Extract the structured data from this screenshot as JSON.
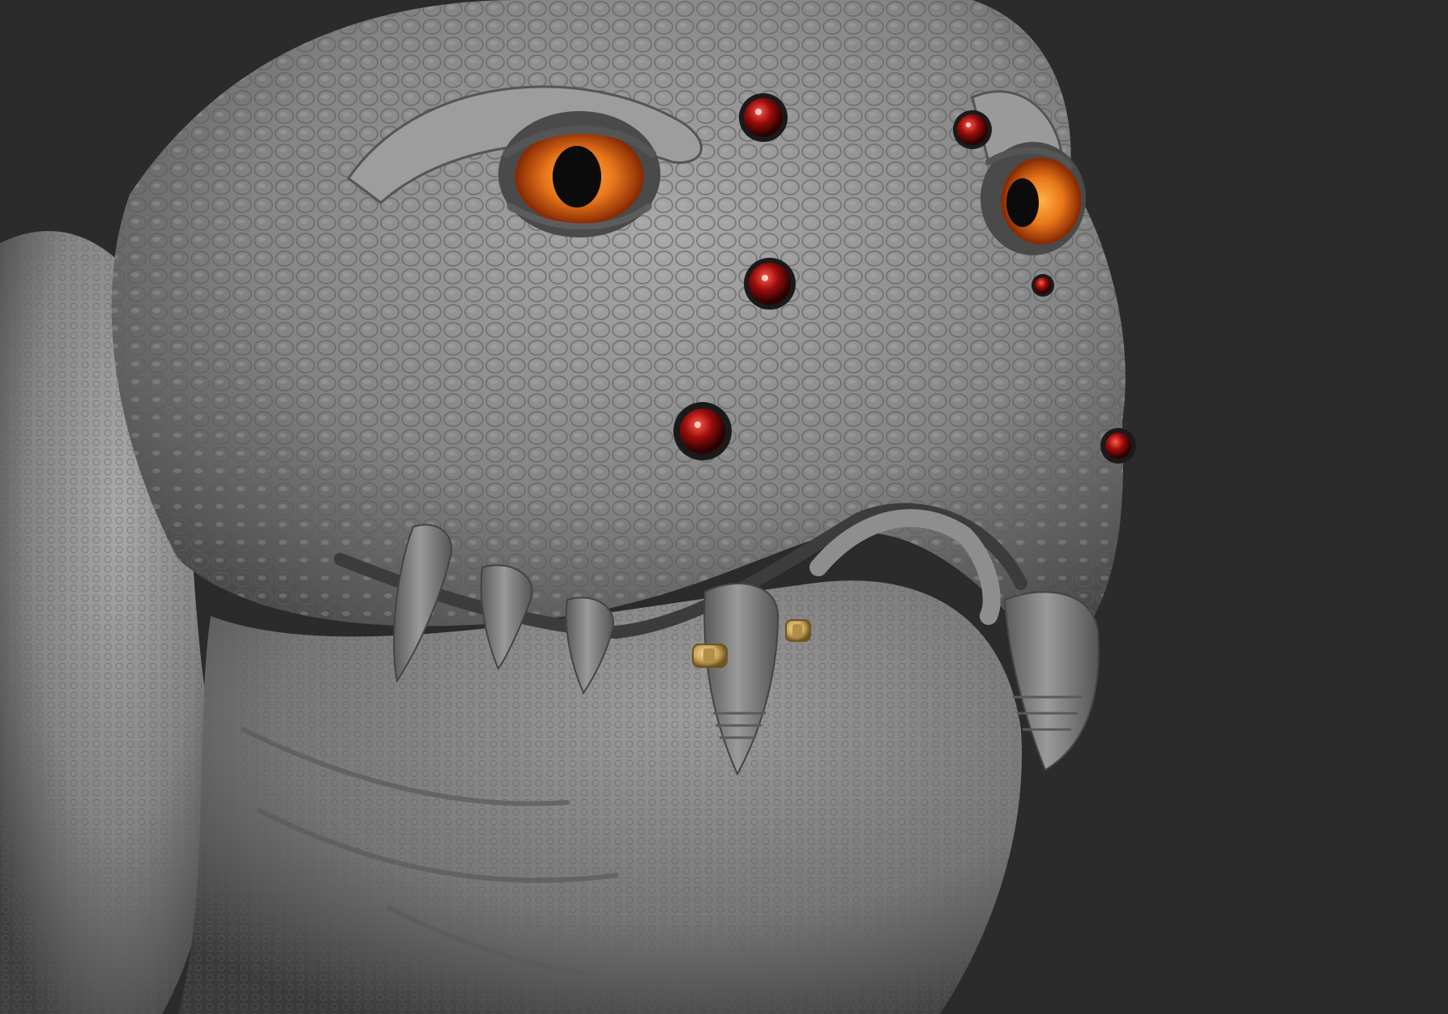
{
  "viewport": {
    "background_color": "#2b2b2b"
  },
  "subject": {
    "icon": "creature-sculpt-render",
    "skin_color": "#8a8a8a",
    "skin_shadow_color": "#4a4a4a",
    "skin_highlight_color": "#b4b4b4",
    "scale_color": "#6f6f6f"
  },
  "main_eyes": {
    "iris_color": "#e8761a",
    "iris_rim_color": "#a43a08",
    "pupil_color": "#0b0b0b",
    "count": 2
  },
  "small_eyes": {
    "color": "#9a0c0c",
    "highlight_color": "#ffd0c8",
    "socket_color": "#1a1a1a",
    "count": 6
  },
  "teeth": {
    "color": "#7c7c7c",
    "count": 6
  },
  "piercings": {
    "color": "#c9a65a",
    "count": 2
  }
}
